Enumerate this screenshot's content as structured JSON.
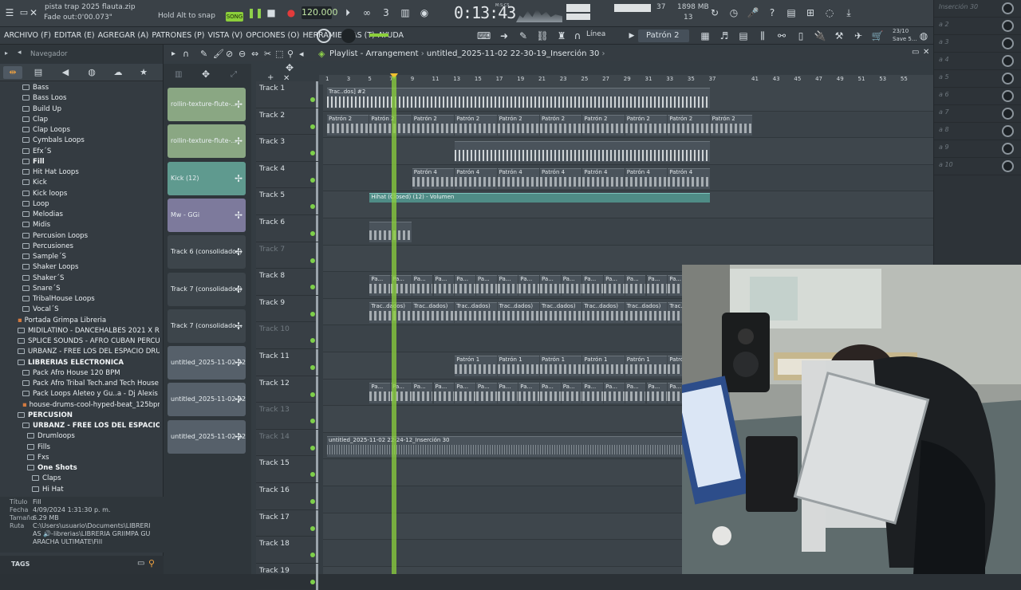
{
  "topbar": {
    "file_title": "pista trap 2025 flauta.zip",
    "fade_out_label": "Fade out:",
    "fade_out_value": "0'00.073\"",
    "hint": "Hold Alt to snap",
    "song_label": "SONG",
    "tempo": "120.000",
    "time": "0:13:43",
    "time_unit": "M:S:CS",
    "cpu_value": "37",
    "memory": "1898 MB",
    "memory_sub": "13",
    "version_date": "23/10",
    "save_label": "Save 5..."
  },
  "menu": {
    "items": [
      "ARCHIVO (F)",
      "EDITAR (E)",
      "AGREGAR (A)",
      "PATRONES (P)",
      "VISTA (V)",
      "OPCIONES (O)",
      "HERRAMIENTAS (T)",
      "AYUDA"
    ],
    "snap_mode": "Línea",
    "pattern": "Patrón 2"
  },
  "browser": {
    "title": "Navegador",
    "tree": [
      {
        "label": "Bass",
        "bold": false,
        "folder": true,
        "indent": 1
      },
      {
        "label": "Bass Loos",
        "bold": false,
        "folder": true,
        "indent": 1
      },
      {
        "label": "Build Up",
        "bold": false,
        "folder": true,
        "indent": 1
      },
      {
        "label": "Clap",
        "bold": false,
        "folder": true,
        "indent": 1
      },
      {
        "label": "Clap Loops",
        "bold": false,
        "folder": true,
        "indent": 1
      },
      {
        "label": "Cymbals Loops",
        "bold": false,
        "folder": true,
        "indent": 1
      },
      {
        "label": "Efx´S",
        "bold": false,
        "folder": true,
        "indent": 1
      },
      {
        "label": "Fill",
        "bold": true,
        "folder": true,
        "indent": 1
      },
      {
        "label": "Hit Hat Loops",
        "bold": false,
        "folder": true,
        "indent": 1
      },
      {
        "label": "Kick",
        "bold": false,
        "folder": true,
        "indent": 1
      },
      {
        "label": "Kick loops",
        "bold": false,
        "folder": true,
        "indent": 1
      },
      {
        "label": "Loop",
        "bold": false,
        "folder": true,
        "indent": 1
      },
      {
        "label": "Melodias",
        "bold": false,
        "folder": true,
        "indent": 1
      },
      {
        "label": "Midis",
        "bold": false,
        "folder": true,
        "indent": 1
      },
      {
        "label": "Percusion Loops",
        "bold": false,
        "folder": true,
        "indent": 1
      },
      {
        "label": "Percusiones",
        "bold": false,
        "folder": true,
        "indent": 1
      },
      {
        "label": "Sample´S",
        "bold": false,
        "folder": true,
        "indent": 1
      },
      {
        "label": "Shaker Loops",
        "bold": false,
        "folder": true,
        "indent": 1
      },
      {
        "label": "Shaker´S",
        "bold": false,
        "folder": true,
        "indent": 1
      },
      {
        "label": "Snare´S",
        "bold": false,
        "folder": true,
        "indent": 1
      },
      {
        "label": "TribalHouse Loops",
        "bold": false,
        "folder": true,
        "indent": 1
      },
      {
        "label": "Vocal´S",
        "bold": false,
        "folder": true,
        "indent": 1
      },
      {
        "label": "Portada Grimpa Libreria",
        "bold": false,
        "folder": false,
        "indent": 0
      },
      {
        "label": "MIDILATINO - DANCEHALBES 2021 X REMAUU",
        "bold": false,
        "folder": true,
        "indent": 0
      },
      {
        "label": "SPLICE SOUNDS - AFRO CUBAN PERCUSSION",
        "bold": false,
        "folder": true,
        "indent": 0
      },
      {
        "label": "URBANZ - FREE LOS DEL ESPACIO DRUM KIT",
        "bold": false,
        "folder": true,
        "indent": 0
      },
      {
        "label": "LIBRERIAS ELECTRONICA",
        "bold": true,
        "folder": true,
        "indent": 0
      },
      {
        "label": "Pack Afro House 120 BPM",
        "bold": false,
        "folder": true,
        "indent": 1
      },
      {
        "label": "Pack Afro Tribal Tech.and Tech House 126BPM",
        "bold": false,
        "folder": true,
        "indent": 1
      },
      {
        "label": "Pack Loops Aleteo y Gu..a - Dj Alexis Delgado",
        "bold": false,
        "folder": true,
        "indent": 1
      },
      {
        "label": "house-drums-cool-hyped-beat_125bpm_C_minor",
        "bold": false,
        "folder": false,
        "indent": 1
      },
      {
        "label": "PERCUSION",
        "bold": true,
        "folder": true,
        "indent": 0
      },
      {
        "label": "URBANZ - FREE LOS DEL ESPACIO DRUM KIT",
        "bold": true,
        "folder": true,
        "indent": 1
      },
      {
        "label": "Drumloops",
        "bold": false,
        "folder": true,
        "indent": 2
      },
      {
        "label": "Fills",
        "bold": false,
        "folder": true,
        "indent": 2
      },
      {
        "label": "Fxs",
        "bold": false,
        "folder": true,
        "indent": 2
      },
      {
        "label": "One Shots",
        "bold": true,
        "folder": true,
        "indent": 2
      },
      {
        "label": "Claps",
        "bold": false,
        "folder": true,
        "indent": 3
      },
      {
        "label": "Hi Hat",
        "bold": false,
        "folder": true,
        "indent": 3
      }
    ],
    "info": {
      "title_label": "Título",
      "title_value": "Fill",
      "date_label": "Fecha",
      "date_value": "4/09/2024 1:31:30 p. m.",
      "size_label": "Tamaño",
      "size_value": "6.29 MB",
      "path_label": "Ruta",
      "path_value": "C:\\Users\\usuario\\Documents\\LIBRERIAS 🔊-librerias\\LIBRERIA GRIIMPA GUARACHA ULTIMATE\\Fill"
    },
    "tags_label": "TAGS"
  },
  "playlist": {
    "title": "Playlist - Arrangement",
    "project": "untitled_2025-11-02 22-30-19_Inserción 30",
    "ruler": [
      "1",
      "3",
      "5",
      "7",
      "9",
      "11",
      "13",
      "15",
      "17",
      "19",
      "21",
      "23",
      "25",
      "27",
      "29",
      "31",
      "33",
      "35",
      "37",
      "41",
      "43",
      "45",
      "47",
      "49",
      "51",
      "53",
      "55"
    ],
    "sources": [
      {
        "label": "rollin-texture-flute-...",
        "color": "#8aa783"
      },
      {
        "label": "rollin-texture-flute-...",
        "color": "#8aa783"
      },
      {
        "label": "Kick (12)",
        "color": "#5f9a8f"
      },
      {
        "label": "Mw - GGi",
        "color": "#7d7a9c"
      },
      {
        "label": "Track 6 (consolidados)",
        "color": "#3d454b"
      },
      {
        "label": "Track 7 (consolidados)",
        "color": "#3d454b"
      },
      {
        "label": "Track 7 (consolidado...",
        "color": "#3d454b"
      },
      {
        "label": "untitled_2025-11-02 22-...",
        "color": "#56606a"
      },
      {
        "label": "untitled_2025-11-02 22-...",
        "color": "#56606a"
      },
      {
        "label": "untitled_2025-11-02 22-...",
        "color": "#56606a"
      }
    ],
    "tracks": [
      {
        "name": "Track 1",
        "dim": false
      },
      {
        "name": "Track 2",
        "dim": false
      },
      {
        "name": "Track 3",
        "dim": false
      },
      {
        "name": "Track 4",
        "dim": false
      },
      {
        "name": "Track 5",
        "dim": false
      },
      {
        "name": "Track 6",
        "dim": false
      },
      {
        "name": "Track 7",
        "dim": true
      },
      {
        "name": "Track 8",
        "dim": false
      },
      {
        "name": "Track 9",
        "dim": false
      },
      {
        "name": "Track 10",
        "dim": true
      },
      {
        "name": "Track 11",
        "dim": false
      },
      {
        "name": "Track 12",
        "dim": false
      },
      {
        "name": "Track 13",
        "dim": true
      },
      {
        "name": "Track 14",
        "dim": true
      },
      {
        "name": "Track 15",
        "dim": false
      },
      {
        "name": "Track 16",
        "dim": false
      },
      {
        "name": "Track 17",
        "dim": false
      },
      {
        "name": "Track 18",
        "dim": false
      },
      {
        "name": "Track 19",
        "dim": false
      }
    ],
    "clips": [
      {
        "row": 0,
        "from": 1,
        "to": 37,
        "kind": "bars",
        "label": "Trac..dos] #2"
      },
      {
        "row": 1,
        "from": 1,
        "to": 41,
        "kind": "notes",
        "label": "Patrón 2",
        "repeat": 10
      },
      {
        "row": 2,
        "from": 13,
        "to": 37,
        "kind": "bars",
        "label": ""
      },
      {
        "row": 3,
        "from": 9,
        "to": 37,
        "kind": "notes",
        "label": "Patrón 4",
        "repeat": 7
      },
      {
        "row": 4,
        "from": 5,
        "to": 37,
        "kind": "auto",
        "label": "Hihat (Closed) (12) - Volumen"
      },
      {
        "row": 5,
        "from": 5,
        "to": 9,
        "kind": "notes",
        "label": ""
      },
      {
        "row": 7,
        "from": 5,
        "to": 37,
        "kind": "notes",
        "label": "Pa...",
        "repeat": 16
      },
      {
        "row": 8,
        "from": 5,
        "to": 37,
        "kind": "notes",
        "label": "Trac..dados)",
        "repeat": 8
      },
      {
        "row": 10,
        "from": 13,
        "to": 37,
        "kind": "notes",
        "label": "Patrón 1",
        "repeat": 6
      },
      {
        "row": 11,
        "from": 5,
        "to": 37,
        "kind": "notes",
        "label": "Pa...",
        "repeat": 16
      },
      {
        "row": 13,
        "from": 1,
        "to": 37,
        "kind": "wave",
        "label": "untitled_2025-11-02 22-24-12_Inserción 30"
      }
    ]
  },
  "mixer": {
    "inserts": [
      "Inserción 30",
      "a 2",
      "a 3",
      "a 4",
      "a 5",
      "a 6",
      "a 7",
      "a 8",
      "a 9",
      "a 10"
    ]
  }
}
